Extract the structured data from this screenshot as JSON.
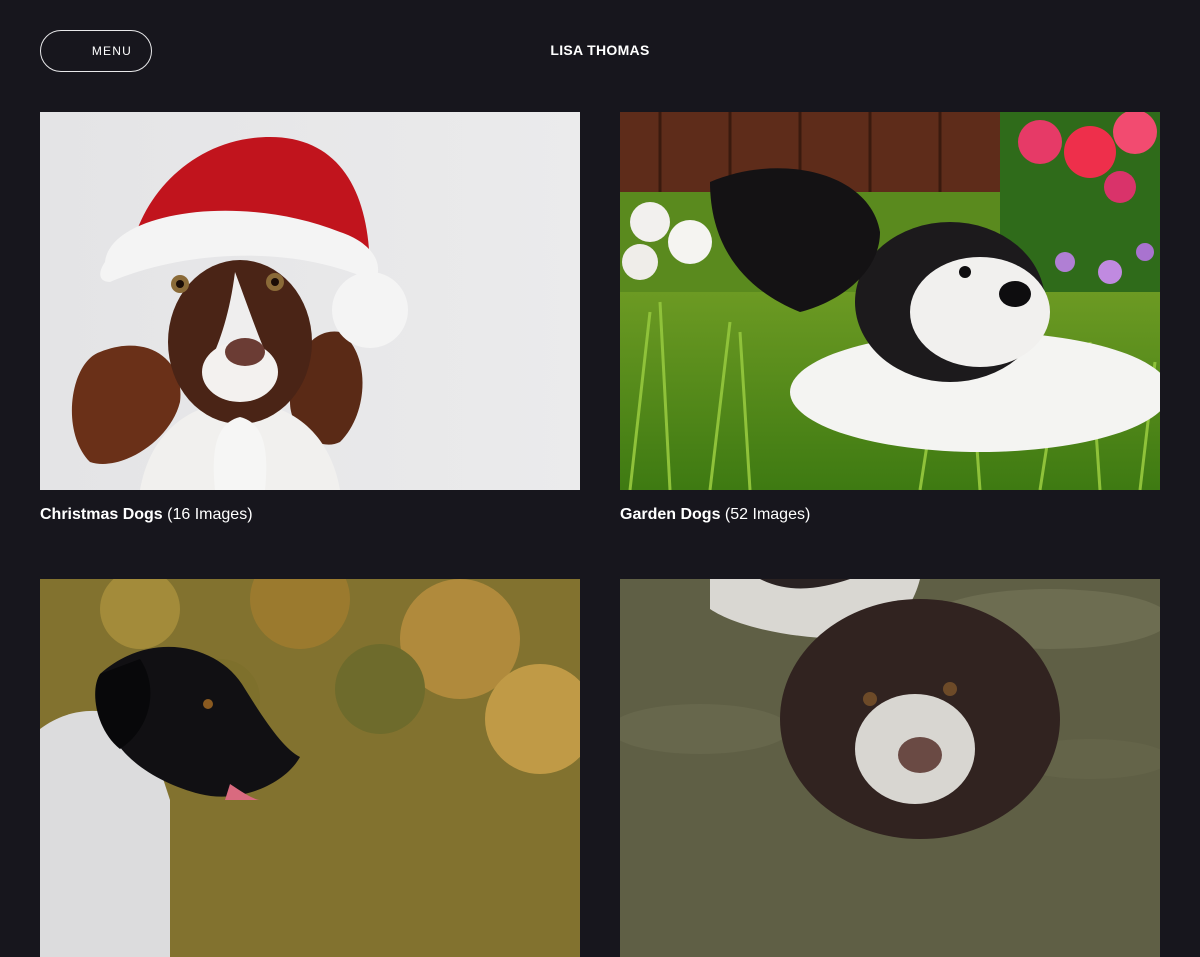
{
  "header": {
    "menu_label": "MENU",
    "site_title": "LISA THOMAS"
  },
  "galleries": [
    {
      "name": "Christmas Dogs",
      "count": "(16 Images)"
    },
    {
      "name": "Garden Dogs",
      "count": "(52 Images)"
    },
    {
      "name": "",
      "count": ""
    },
    {
      "name": "",
      "count": ""
    }
  ]
}
